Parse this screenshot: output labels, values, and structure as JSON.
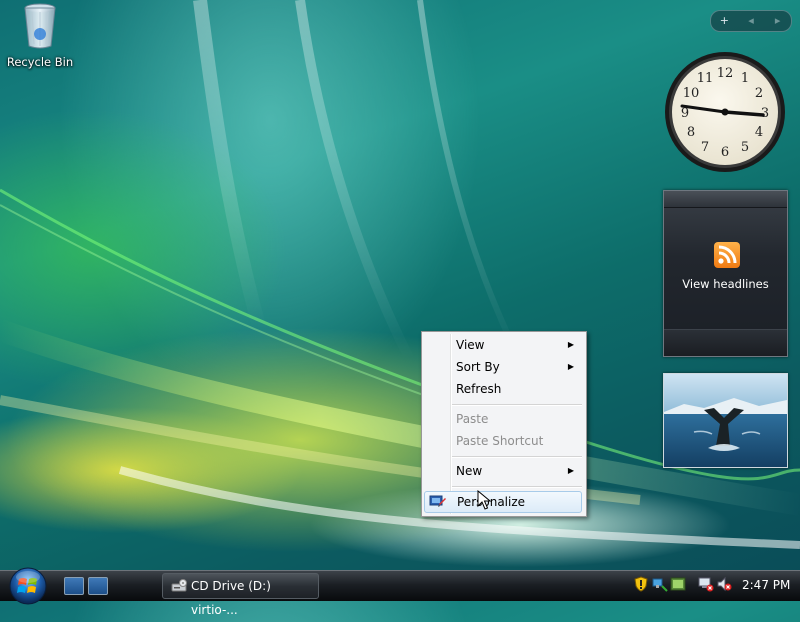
{
  "desktop": {
    "icons": [
      {
        "label": "Recycle Bin",
        "icon": "recycle-bin-icon"
      }
    ]
  },
  "sidebar": {
    "controls": {
      "add": "+",
      "prev": "◂",
      "next": "▸"
    },
    "clock": {
      "time_shown": "2:47",
      "numbers": [
        "12",
        "1",
        "2",
        "3",
        "4",
        "5",
        "6",
        "7",
        "8",
        "9",
        "10",
        "11"
      ]
    },
    "feed": {
      "label": "View headlines",
      "icon": "rss-icon"
    },
    "slideshow": {
      "subject": "whale-tail-photo"
    }
  },
  "context_menu": {
    "items": [
      {
        "label": "View",
        "submenu": true,
        "disabled": false
      },
      {
        "label": "Sort By",
        "submenu": true,
        "disabled": false
      },
      {
        "label": "Refresh",
        "submenu": false,
        "disabled": false
      },
      {
        "label": "Paste",
        "submenu": false,
        "disabled": true
      },
      {
        "label": "Paste Shortcut",
        "submenu": false,
        "disabled": true
      },
      {
        "label": "New",
        "submenu": true,
        "disabled": false
      },
      {
        "label": "Personalize",
        "submenu": false,
        "disabled": false,
        "highlighted": true
      }
    ]
  },
  "taskbar": {
    "quick_launch": [
      "show-desktop-icon",
      "switch-windows-icon"
    ],
    "tasks": [
      {
        "label": "CD Drive (D:) virtio-...",
        "icon": "cd-drive-icon"
      }
    ],
    "tray": {
      "icons": [
        "security-shield-icon",
        "network-icon",
        "windows-defender-icon",
        "network-disconnected-icon",
        "volume-muted-icon"
      ],
      "time": "2:47 PM"
    }
  },
  "colors": {
    "menu_highlight": "#dcebf8",
    "taskbar": "#1b1f24",
    "rss": "#f07a12"
  }
}
